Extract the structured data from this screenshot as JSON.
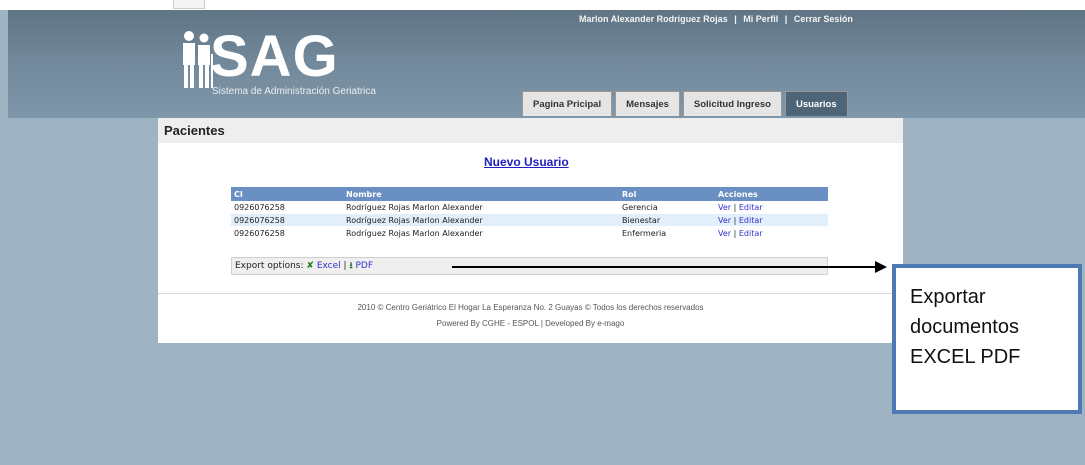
{
  "header": {
    "user_name": "Marlon Alexander Rodríguez Rojas",
    "separator": "|",
    "profile_link": "Mi Perfil",
    "logout_link": "Cerrar Sesión",
    "logo_text": "SAG",
    "logo_subtitle": "Sistema de Administración Geriatrica"
  },
  "tabs": [
    {
      "label": "Pagina Pricipal"
    },
    {
      "label": "Mensajes"
    },
    {
      "label": "Solicitud Ingreso"
    },
    {
      "label": "Usuarios"
    }
  ],
  "page": {
    "title": "Pacientes",
    "new_user_link": "Nuevo Usuario"
  },
  "table": {
    "headers": [
      "CI",
      "Nombre",
      "Rol",
      "Acciones"
    ],
    "rows": [
      {
        "ci": "0926076258",
        "nombre": "Rodríguez Rojas Marlon Alexander",
        "rol": "Gerencia",
        "ver": "Ver",
        "sep": "|",
        "editar": "Editar"
      },
      {
        "ci": "0926076258",
        "nombre": "Rodríguez Rojas Marlon Alexander",
        "rol": "Bienestar",
        "ver": "Ver",
        "sep": "|",
        "editar": "Editar"
      },
      {
        "ci": "0926076258",
        "nombre": "Rodríguez Rojas Marlon Alexander",
        "rol": "Enfermeria",
        "ver": "Ver",
        "sep": "|",
        "editar": "Editar"
      }
    ]
  },
  "export": {
    "label": "Export options:",
    "excel": "Excel",
    "separator": "|",
    "pdf": "PDF"
  },
  "footer": {
    "line1": "2010 © Centro Geriátrico El Hogar La Esperanza No. 2 Guayas © Todos los derechos reservados",
    "line2": "Powered By CGHE - ESPOL | Developed By e-mago"
  },
  "annotation": {
    "line1": "Exportar",
    "line2": "documentos",
    "line3": "EXCEL PDF"
  }
}
